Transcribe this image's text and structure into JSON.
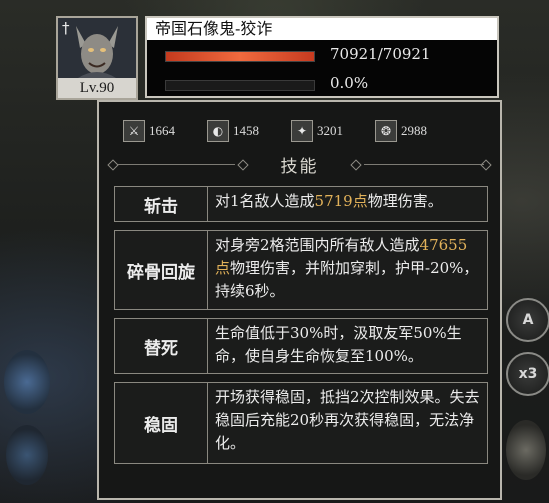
{
  "unit": {
    "name": "帝国石像鬼-狡诈",
    "level": "Lv.90",
    "hp_text": "70921/70921",
    "hp_fraction": 1.0,
    "secondary_text": "0.0%",
    "secondary_fraction": 0.0
  },
  "stats": [
    {
      "icon": "attack-stat-icon",
      "glyph": "⚔",
      "value": "1664"
    },
    {
      "icon": "defense-stat-icon",
      "glyph": "◐",
      "value": "1458"
    },
    {
      "icon": "magic-attack-stat-icon",
      "glyph": "✦",
      "value": "3201"
    },
    {
      "icon": "magic-defense-stat-icon",
      "glyph": "❂",
      "value": "2988"
    }
  ],
  "section_title": "技能",
  "skills": [
    {
      "name": "斩击",
      "desc_pre": "对1名敌人造成",
      "desc_hl": "5719点",
      "desc_post": "物理伤害。"
    },
    {
      "name": "碎骨回旋",
      "desc_pre": "对身旁2格范围内所有敌人造成",
      "desc_hl": "47655点",
      "desc_post": "物理伤害，并附加穿刺，护甲-20%，持续6秒。"
    },
    {
      "name": "替死",
      "desc_pre": "生命值低于30%时，汲取友军50%生命，使自身生命恢复至100%。",
      "desc_hl": "",
      "desc_post": ""
    },
    {
      "name": "稳固",
      "desc_pre": "开场获得稳固，抵挡2次控制效果。失去稳固后充能20秒再次获得稳固，无法净化。",
      "desc_hl": "",
      "desc_post": ""
    }
  ],
  "side_buttons": {
    "auto": "A",
    "speed": "x3"
  },
  "colors": {
    "hp": "#e0522e",
    "highlight": "#e2b25a",
    "panel_border": "#b9b6ad"
  }
}
